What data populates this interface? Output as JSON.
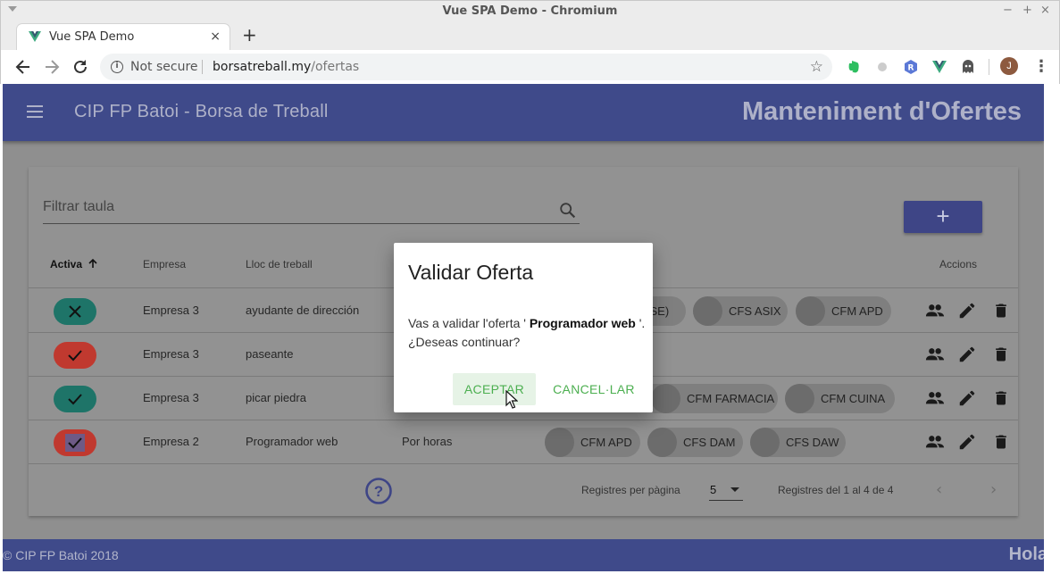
{
  "browser": {
    "window_title": "Vue SPA Demo - Chromium",
    "window_controls": {
      "minimize": "−",
      "maximize": "+",
      "close": "×"
    },
    "tab": {
      "title": "Vue SPA Demo",
      "close": "×"
    },
    "new_tab": "+",
    "omnibox": {
      "security": "Not secure",
      "host": "borsatreball.my",
      "path": "/ofertas"
    },
    "profile_initial": "J",
    "accent_color": "#3f4a8a"
  },
  "header": {
    "app_title": "CIP FP Batoi - Borsa de Treball",
    "page_title": "Manteniment d'Ofertes"
  },
  "filter": {
    "placeholder": "Filtrar taula"
  },
  "add_button": "+",
  "table": {
    "columns": {
      "activa": "Activa",
      "empresa": "Empresa",
      "lloc": "Lloc de treball",
      "accions": "Accions"
    },
    "rows": [
      {
        "active": false,
        "empresa": "Empresa 3",
        "lloc": "ayudante de dirección",
        "contracte": "",
        "cicles": [
          "...SSE)",
          "CFS ASIX",
          "CFM APD"
        ]
      },
      {
        "active": true,
        "empresa": "Empresa 3",
        "lloc": "paseante",
        "contracte": "",
        "cicles": []
      },
      {
        "active": true,
        "empresa": "Empresa 3",
        "lloc": "picar piedra",
        "contracte": "",
        "cicles": [
          "",
          "CFM FARMACIA",
          "CFM CUINA"
        ]
      },
      {
        "active": true,
        "empresa": "Empresa 2",
        "lloc": "Programador web",
        "contracte": "Por horas",
        "cicles": [
          "CFM APD",
          "CFS DAM",
          "CFS DAW"
        ]
      }
    ],
    "footer": {
      "rows_per_page_label": "Registres per pàgina",
      "rows_per_page": "5",
      "range": "Registres del 1 al 4 de 4"
    }
  },
  "app_footer": {
    "copyright": "© CIP FP Batoi 2018",
    "greeting": "Hola"
  },
  "dialog": {
    "title": "Validar Oferta",
    "message_prefix": "Vas a validar l'oferta '",
    "offer_name": "Programador web",
    "message_suffix": "'. ¿Deseas continuar?",
    "accept": "ACEPTAR",
    "cancel": "CANCEL·LAR"
  }
}
